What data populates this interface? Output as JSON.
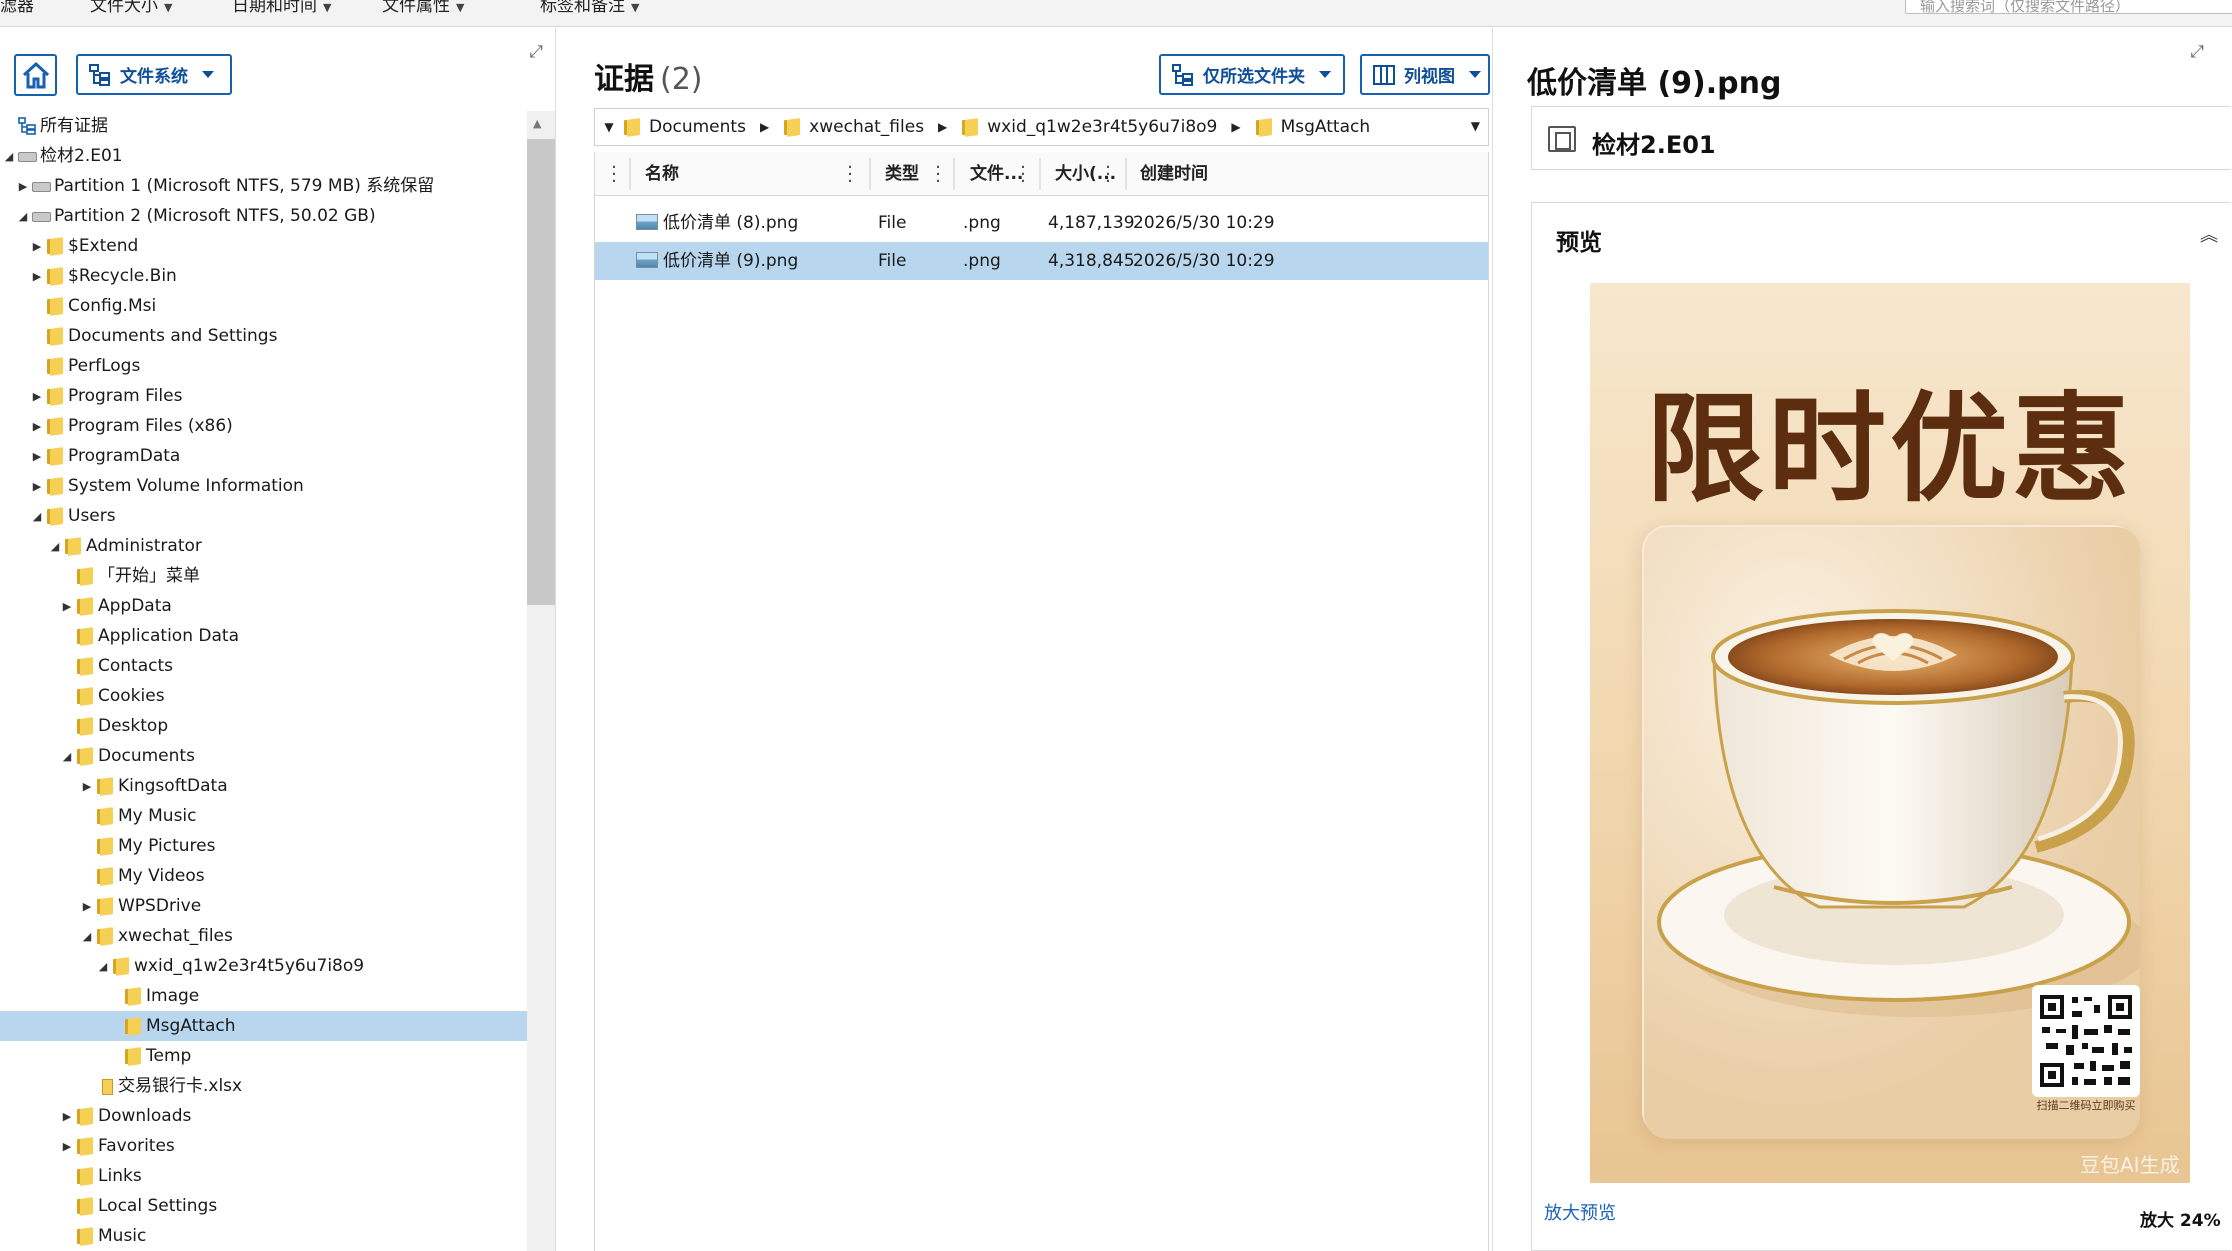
{
  "filter_bar": {
    "items": [
      "滤器",
      "文件大小",
      "日期和时间",
      "文件属性",
      "标签和备注"
    ],
    "search_placeholder": "输入搜索词（仅搜索文件路径）"
  },
  "left_panel": {
    "view_button": "文件系统",
    "tree": [
      {
        "label": "所有证据",
        "depth": 0,
        "toggle": "none",
        "icon": "tree-root-icon"
      },
      {
        "label": "检材2.E01",
        "depth": 0,
        "toggle": "expanded",
        "icon": "disk-icon"
      },
      {
        "label": "Partition 1 (Microsoft NTFS, 579 MB) 系统保留",
        "depth": 1,
        "toggle": "collapsed",
        "icon": "disk-icon"
      },
      {
        "label": "Partition 2 (Microsoft NTFS, 50.02 GB)",
        "depth": 1,
        "toggle": "expanded",
        "icon": "disk-icon"
      },
      {
        "label": "$Extend",
        "depth": 2,
        "toggle": "collapsed",
        "icon": "folder-icon"
      },
      {
        "label": "$Recycle.Bin",
        "depth": 2,
        "toggle": "collapsed",
        "icon": "folder-icon"
      },
      {
        "label": "Config.Msi",
        "depth": 2,
        "toggle": "none",
        "icon": "folder-icon"
      },
      {
        "label": "Documents and Settings",
        "depth": 2,
        "toggle": "none",
        "icon": "folder-icon"
      },
      {
        "label": "PerfLogs",
        "depth": 2,
        "toggle": "none",
        "icon": "folder-icon"
      },
      {
        "label": "Program Files",
        "depth": 2,
        "toggle": "collapsed",
        "icon": "folder-icon"
      },
      {
        "label": "Program Files (x86)",
        "depth": 2,
        "toggle": "collapsed",
        "icon": "folder-icon"
      },
      {
        "label": "ProgramData",
        "depth": 2,
        "toggle": "collapsed",
        "icon": "folder-icon"
      },
      {
        "label": "System Volume Information",
        "depth": 2,
        "toggle": "collapsed",
        "icon": "folder-icon"
      },
      {
        "label": "Users",
        "depth": 2,
        "toggle": "expanded",
        "icon": "folder-icon"
      },
      {
        "label": "Administrator",
        "depth": 3,
        "toggle": "expanded",
        "icon": "folder-icon"
      },
      {
        "label": "「开始」菜单",
        "depth": 4,
        "toggle": "none",
        "icon": "folder-icon"
      },
      {
        "label": "AppData",
        "depth": 4,
        "toggle": "collapsed",
        "icon": "folder-icon"
      },
      {
        "label": "Application Data",
        "depth": 4,
        "toggle": "none",
        "icon": "folder-icon"
      },
      {
        "label": "Contacts",
        "depth": 4,
        "toggle": "none",
        "icon": "folder-icon"
      },
      {
        "label": "Cookies",
        "depth": 4,
        "toggle": "none",
        "icon": "folder-icon"
      },
      {
        "label": "Desktop",
        "depth": 4,
        "toggle": "none",
        "icon": "folder-icon"
      },
      {
        "label": "Documents",
        "depth": 4,
        "toggle": "expanded",
        "icon": "folder-icon"
      },
      {
        "label": "KingsoftData",
        "depth": 5,
        "toggle": "collapsed",
        "icon": "folder-icon"
      },
      {
        "label": "My Music",
        "depth": 5,
        "toggle": "none",
        "icon": "folder-icon"
      },
      {
        "label": "My Pictures",
        "depth": 5,
        "toggle": "none",
        "icon": "folder-icon"
      },
      {
        "label": "My Videos",
        "depth": 5,
        "toggle": "none",
        "icon": "folder-icon"
      },
      {
        "label": "WPSDrive",
        "depth": 5,
        "toggle": "collapsed",
        "icon": "folder-icon"
      },
      {
        "label": "xwechat_files",
        "depth": 5,
        "toggle": "expanded",
        "icon": "folder-icon"
      },
      {
        "label": "wxid_q1w2e3r4t5y6u7i8o9",
        "depth": 6,
        "toggle": "expanded",
        "icon": "folder-icon"
      },
      {
        "label": "Image",
        "depth": 7,
        "toggle": "none",
        "icon": "folder-icon"
      },
      {
        "label": "MsgAttach",
        "depth": 7,
        "toggle": "none",
        "icon": "folder-icon",
        "selected": true
      },
      {
        "label": "Temp",
        "depth": 7,
        "toggle": "none",
        "icon": "folder-icon"
      },
      {
        "label": "交易银行卡.xlsx",
        "depth": 5,
        "toggle": "none",
        "icon": "file-icon"
      },
      {
        "label": "Downloads",
        "depth": 4,
        "toggle": "collapsed",
        "icon": "folder-icon"
      },
      {
        "label": "Favorites",
        "depth": 4,
        "toggle": "collapsed",
        "icon": "folder-icon"
      },
      {
        "label": "Links",
        "depth": 4,
        "toggle": "none",
        "icon": "folder-icon"
      },
      {
        "label": "Local Settings",
        "depth": 4,
        "toggle": "none",
        "icon": "folder-icon"
      },
      {
        "label": "Music",
        "depth": 4,
        "toggle": "none",
        "icon": "folder-icon"
      }
    ]
  },
  "middle_panel": {
    "title": "证据",
    "count": "(2)",
    "filter_button": "仅所选文件夹",
    "view_button": "列视图",
    "breadcrumb": [
      "Documents",
      "xwechat_files",
      "wxid_q1w2e3r4t5y6u7i8o9",
      "MsgAttach"
    ],
    "columns": [
      "名称",
      "类型",
      "文件...",
      "大小(...",
      "创建时间"
    ],
    "rows": [
      {
        "name": "低价清单 (8).png",
        "type": "File",
        "ext": ".png",
        "size": "4,187,139",
        "created": "2026/5/30 10:29",
        "selected": false
      },
      {
        "name": "低价清单 (9).png",
        "type": "File",
        "ext": ".png",
        "size": "4,318,845",
        "created": "2026/5/30 10:29",
        "selected": true
      }
    ]
  },
  "right_panel": {
    "title": "低价清单 (9).png",
    "source": "检材2.E01",
    "preview_label": "预览",
    "poster": {
      "headline": "限时优惠",
      "qr_caption": "扫描二维码立即购买",
      "watermark": "豆包AI生成"
    },
    "zoom_link": "放大预览",
    "zoom_level": "放大 24%"
  },
  "colors": {
    "accent": "#1560b0",
    "selection": "#b8d7ee",
    "poster_text": "#5d2d10"
  }
}
